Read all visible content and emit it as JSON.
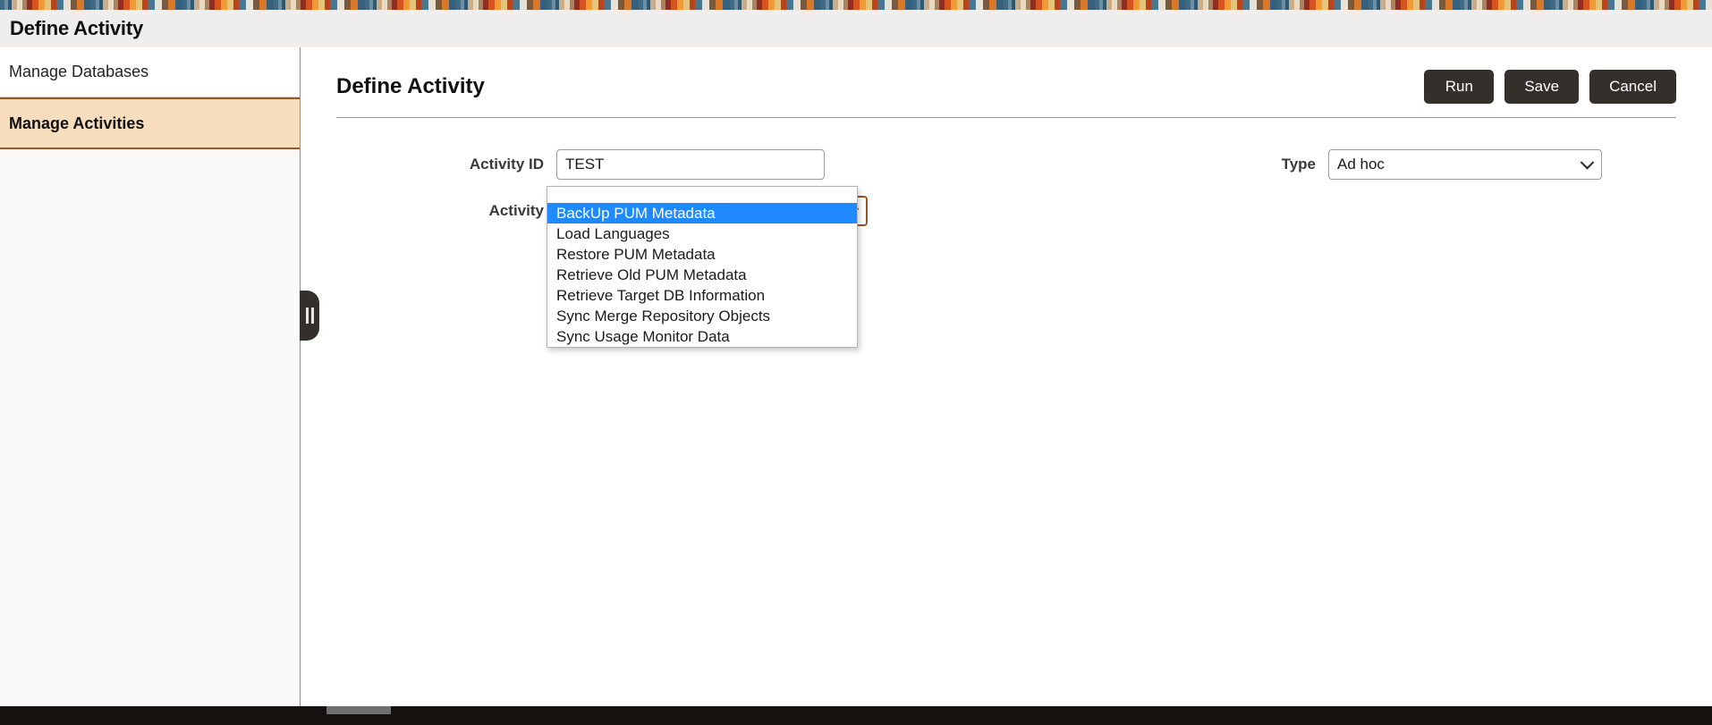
{
  "window": {
    "title": "Define Activity"
  },
  "sidebar": {
    "items": [
      {
        "label": "Manage Databases",
        "selected": false
      },
      {
        "label": "Manage Activities",
        "selected": true
      }
    ],
    "collapse_handle": "collapse-sidebar"
  },
  "main": {
    "page_title": "Define Activity",
    "actions": [
      {
        "label": "Run",
        "name": "run-button"
      },
      {
        "label": "Save",
        "name": "save-button"
      },
      {
        "label": "Cancel",
        "name": "cancel-button"
      }
    ],
    "form": {
      "activity_id": {
        "label": "Activity ID",
        "value": "TEST",
        "placeholder": ""
      },
      "activity": {
        "label": "Activity",
        "value": "",
        "expanded": true,
        "options": [
          "",
          "BackUp PUM Metadata",
          "Load Languages",
          "Restore PUM Metadata",
          "Retrieve Old PUM Metadata",
          "Retrieve Target DB Information",
          "Sync Merge Repository Objects",
          "Sync Usage Monitor Data"
        ],
        "highlighted_option": "BackUp PUM Metadata"
      },
      "type": {
        "label": "Type",
        "value": "Ad hoc"
      }
    }
  },
  "colors": {
    "accent_selected": "#f6ddbe",
    "accent_border": "#9a5624",
    "highlight_blue": "#1f8aff",
    "button_dark": "#332f2b",
    "header_bg": "#efeeec"
  }
}
